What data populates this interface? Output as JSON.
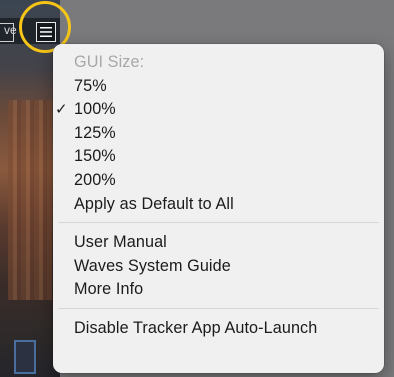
{
  "plugin": {
    "top_text": "ve"
  },
  "menu": {
    "section_gui": {
      "header": "GUI Size:",
      "options": [
        {
          "label": "75%",
          "checked": false
        },
        {
          "label": "100%",
          "checked": true
        },
        {
          "label": "125%",
          "checked": false
        },
        {
          "label": "150%",
          "checked": false
        },
        {
          "label": "200%",
          "checked": false
        }
      ],
      "apply_default": "Apply as Default to All"
    },
    "section_help": {
      "user_manual": "User Manual",
      "system_guide": "Waves System Guide",
      "more_info": "More Info"
    },
    "section_tracker": {
      "disable_autolaunch": "Disable Tracker App Auto-Launch"
    },
    "check_glyph": "✓"
  },
  "colors": {
    "highlight": "#f5c518",
    "menu_bg": "#f0f0f0",
    "disabled_text": "#a8a8a8"
  }
}
